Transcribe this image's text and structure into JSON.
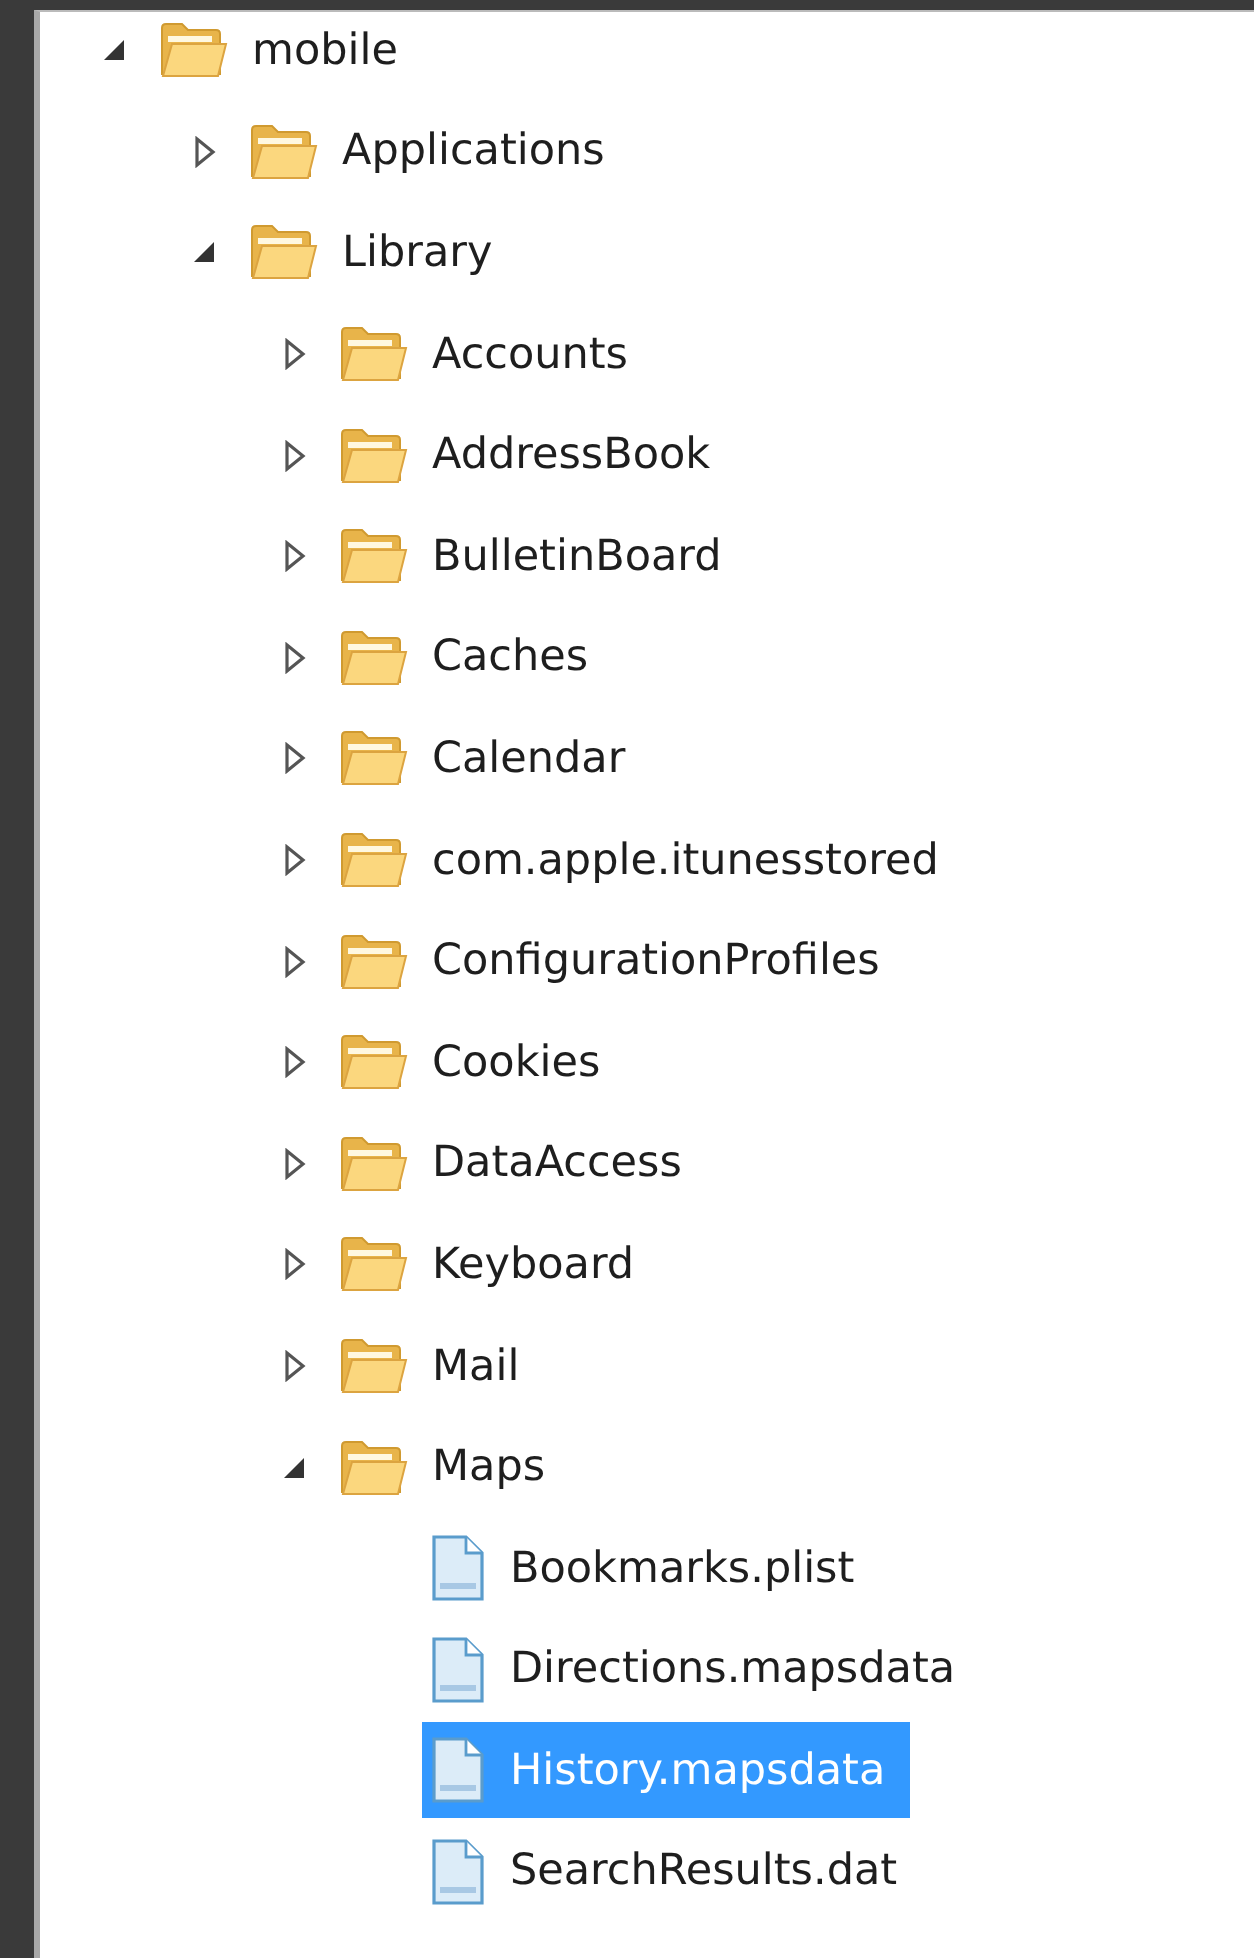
{
  "tree": [
    {
      "name": "mobile",
      "kind": "folder",
      "expanded": true,
      "selected": false,
      "children": [
        {
          "name": "Applications",
          "kind": "folder",
          "expanded": false,
          "selected": false
        },
        {
          "name": "Library",
          "kind": "folder",
          "expanded": true,
          "selected": false,
          "children": [
            {
              "name": "Accounts",
              "kind": "folder",
              "expanded": false,
              "selected": false
            },
            {
              "name": "AddressBook",
              "kind": "folder",
              "expanded": false,
              "selected": false
            },
            {
              "name": "BulletinBoard",
              "kind": "folder",
              "expanded": false,
              "selected": false
            },
            {
              "name": "Caches",
              "kind": "folder",
              "expanded": false,
              "selected": false
            },
            {
              "name": "Calendar",
              "kind": "folder",
              "expanded": false,
              "selected": false
            },
            {
              "name": "com.apple.itunesstored",
              "kind": "folder",
              "expanded": false,
              "selected": false
            },
            {
              "name": "ConfigurationProfiles",
              "kind": "folder",
              "expanded": false,
              "selected": false
            },
            {
              "name": "Cookies",
              "kind": "folder",
              "expanded": false,
              "selected": false
            },
            {
              "name": "DataAccess",
              "kind": "folder",
              "expanded": false,
              "selected": false
            },
            {
              "name": "Keyboard",
              "kind": "folder",
              "expanded": false,
              "selected": false
            },
            {
              "name": "Mail",
              "kind": "folder",
              "expanded": false,
              "selected": false
            },
            {
              "name": "Maps",
              "kind": "folder",
              "expanded": true,
              "selected": false,
              "children": [
                {
                  "name": "Bookmarks.plist",
                  "kind": "file",
                  "selected": false
                },
                {
                  "name": "Directions.mapsdata",
                  "kind": "file",
                  "selected": false
                },
                {
                  "name": "History.mapsdata",
                  "kind": "file",
                  "selected": true
                },
                {
                  "name": "SearchResults.dat",
                  "kind": "file",
                  "selected": false
                }
              ]
            }
          ]
        }
      ]
    }
  ]
}
